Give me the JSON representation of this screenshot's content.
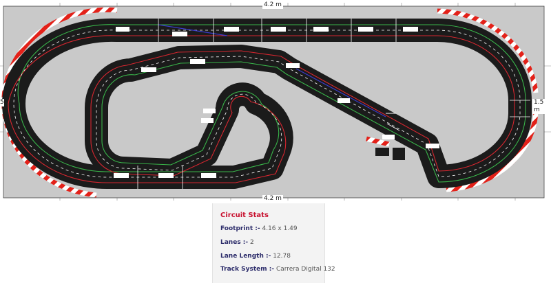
{
  "plan": {
    "board_width_label": "4.2 m",
    "board_height_label": "1.5 m",
    "board_height_label_left": "5",
    "colors": {
      "board": "#c9c9c9",
      "track": "#1b1b1b",
      "lane_inner": "#39b54a",
      "lane_outer": "#d7262f",
      "curb_red": "#e32119",
      "curb_white": "#ffffff"
    }
  },
  "stats": {
    "title": "Circuit Stats",
    "rows": [
      {
        "label": "Footprint :-",
        "value": "4.16 x 1.49"
      },
      {
        "label": "Lanes :-",
        "value": "2"
      },
      {
        "label": "Lane Length :-",
        "value": "12.78"
      },
      {
        "label": "Track System :-",
        "value": "Carrera Digital 132"
      }
    ]
  }
}
